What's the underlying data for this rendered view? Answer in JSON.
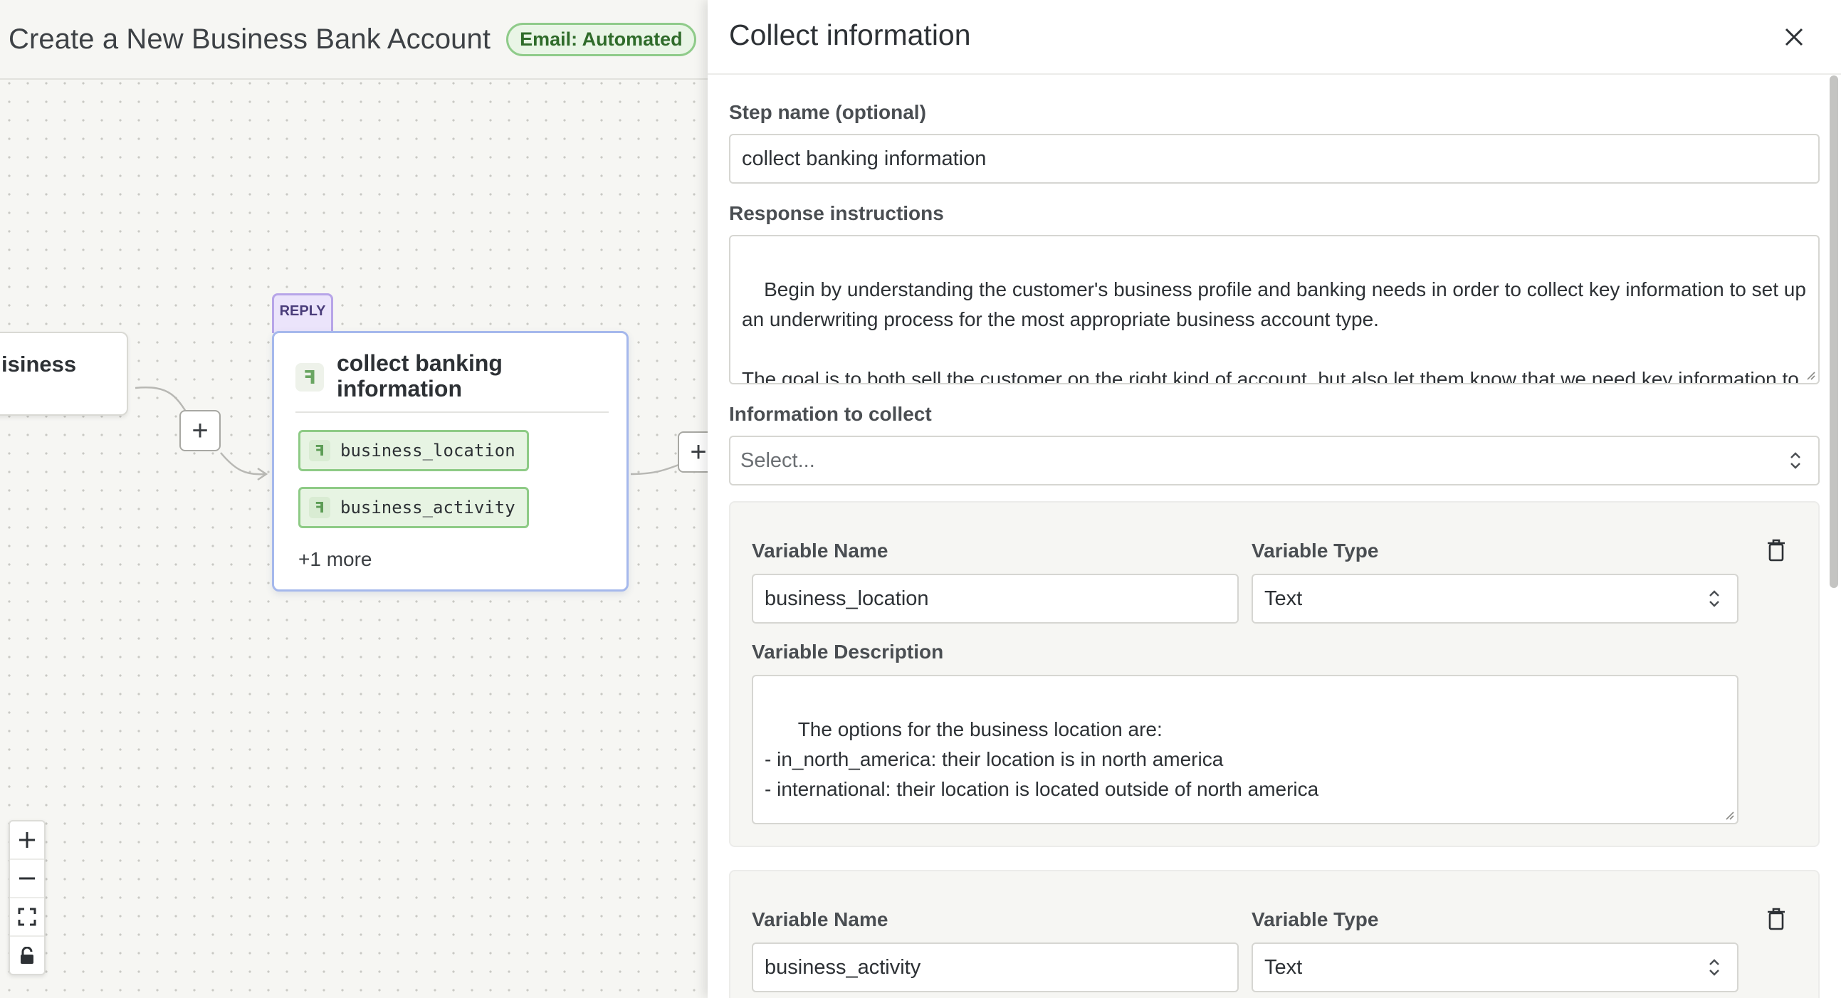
{
  "flow": {
    "title": "Create a New Business Bank Account",
    "badge": "Email: Automated"
  },
  "canvas": {
    "left_node_label": "isiness",
    "reply_tag": "REPLY",
    "reply_node": {
      "title": "collect banking information",
      "variables": [
        "business_location",
        "business_activity"
      ],
      "more": "+1 more"
    },
    "plus_label": "+",
    "zoom": {
      "in": "+",
      "out": "—"
    }
  },
  "panel": {
    "title": "Collect information",
    "step_name": {
      "label": "Step name (optional)",
      "value": "collect banking information"
    },
    "response_instructions": {
      "label": "Response instructions",
      "value": "Begin by understanding the customer's business profile and banking needs in order to collect key information to set up an underwriting process for the most appropriate business account type.\n\nThe goal is to both sell the customer on the right kind of account, but also let them know that we need key information to kick off the approval process. Don't use the term underwriting."
    },
    "information_to_collect": {
      "label": "Information to collect",
      "placeholder": "Select..."
    },
    "variables": [
      {
        "name_label": "Variable Name",
        "name_value": "business_location",
        "type_label": "Variable Type",
        "type_value": "Text",
        "description_label": "Variable Description",
        "description_value": "The options for the business location are:\n- in_north_america: their location is in north america\n- international: their location is located outside of north america"
      },
      {
        "name_label": "Variable Name",
        "name_value": "business_activity",
        "type_label": "Variable Type",
        "type_value": "Text"
      }
    ]
  }
}
